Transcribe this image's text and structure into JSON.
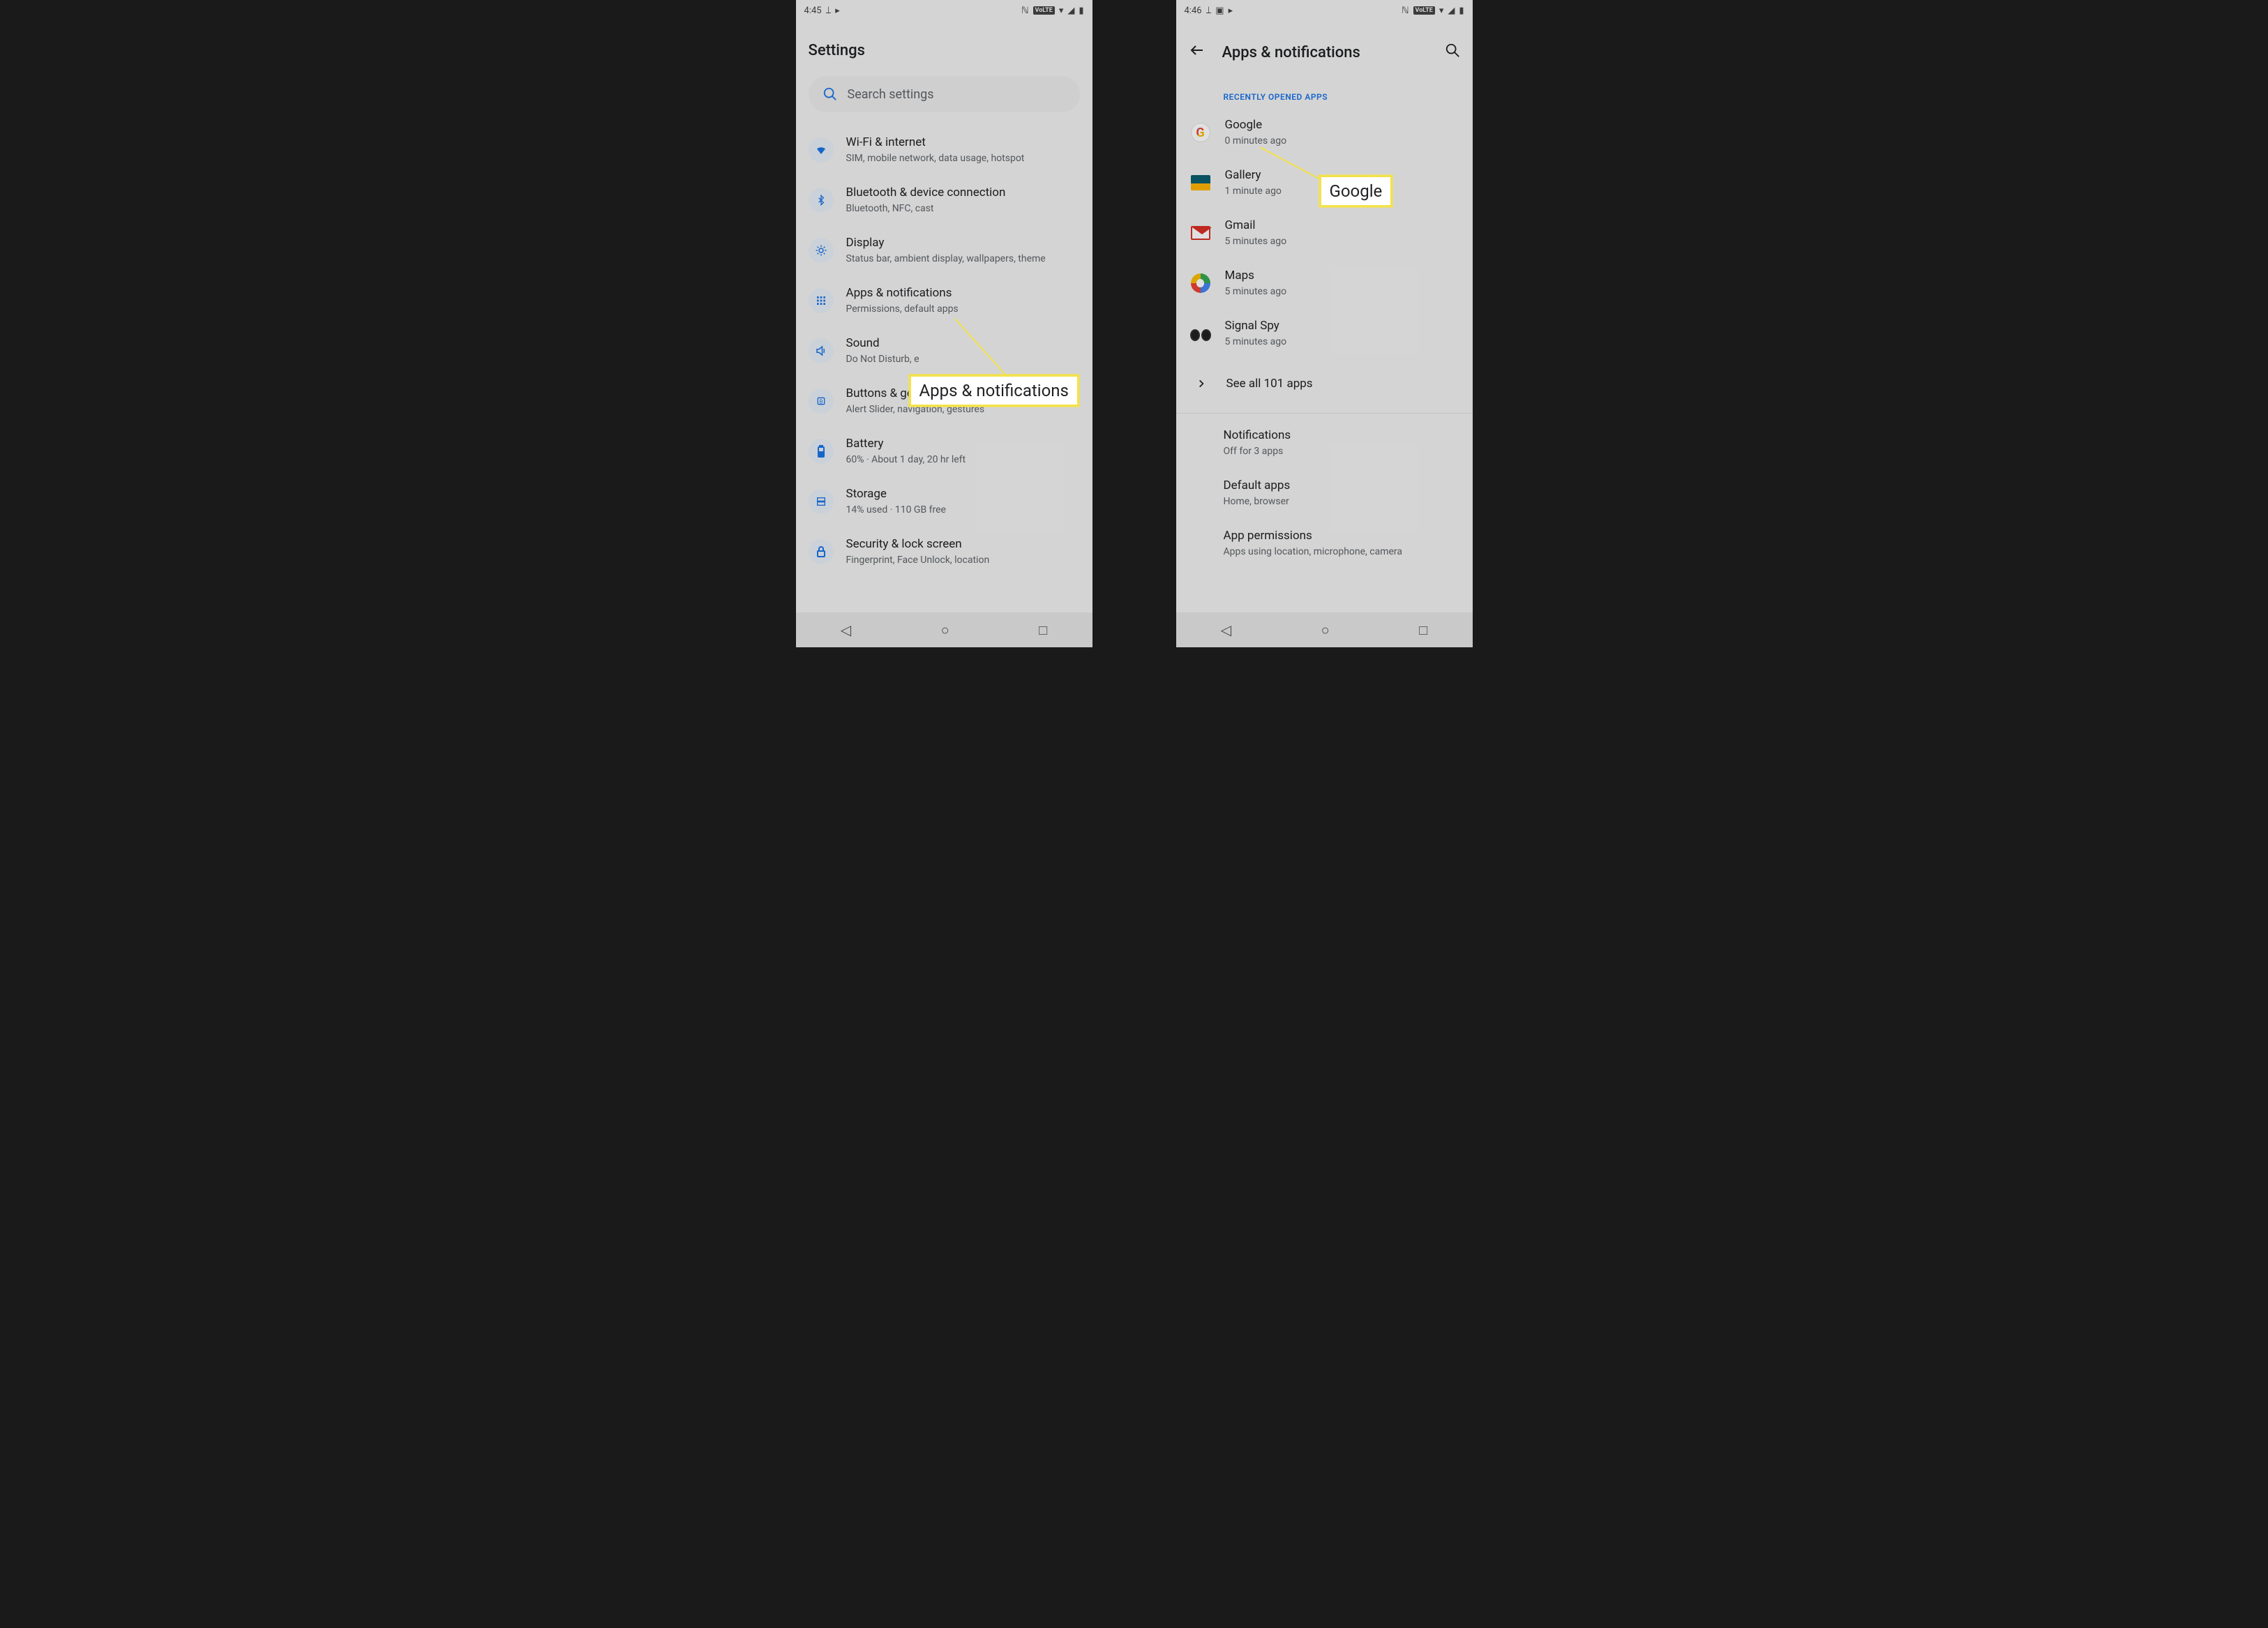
{
  "left": {
    "status": {
      "time": "4:45"
    },
    "header": {
      "title": "Settings"
    },
    "search": {
      "placeholder": "Search settings"
    },
    "items": [
      {
        "title": "Wi-Fi & internet",
        "sub": "SIM, mobile network, data usage, hotspot"
      },
      {
        "title": "Bluetooth & device connection",
        "sub": "Bluetooth, NFC, cast"
      },
      {
        "title": "Display",
        "sub": "Status bar, ambient display, wallpapers, theme"
      },
      {
        "title": "Apps & notifications",
        "sub": "Permissions, default apps"
      },
      {
        "title": "Sound",
        "sub": "Do Not Disturb, e"
      },
      {
        "title": "Buttons & gestures",
        "sub": "Alert Slider, navigation, gestures"
      },
      {
        "title": "Battery",
        "sub": "60% · About 1 day, 20 hr left"
      },
      {
        "title": "Storage",
        "sub": "14% used · 110 GB free"
      },
      {
        "title": "Security & lock screen",
        "sub": "Fingerprint, Face Unlock, location"
      }
    ],
    "callout": "Apps & notifications"
  },
  "right": {
    "status": {
      "time": "4:46"
    },
    "header": {
      "title": "Apps & notifications"
    },
    "section_label": "RECENTLY OPENED APPS",
    "apps": [
      {
        "title": "Google",
        "sub": "0 minutes ago"
      },
      {
        "title": "Gallery",
        "sub": "1 minute ago"
      },
      {
        "title": "Gmail",
        "sub": "5 minutes ago"
      },
      {
        "title": "Maps",
        "sub": "5 minutes ago"
      },
      {
        "title": "Signal Spy",
        "sub": "5 minutes ago"
      }
    ],
    "see_all": "See all 101 apps",
    "more": [
      {
        "title": "Notifications",
        "sub": "Off for 3 apps"
      },
      {
        "title": "Default apps",
        "sub": "Home, browser"
      },
      {
        "title": "App permissions",
        "sub": "Apps using location, microphone, camera"
      }
    ],
    "callout": "Google"
  },
  "status_volte": "VoLTE"
}
